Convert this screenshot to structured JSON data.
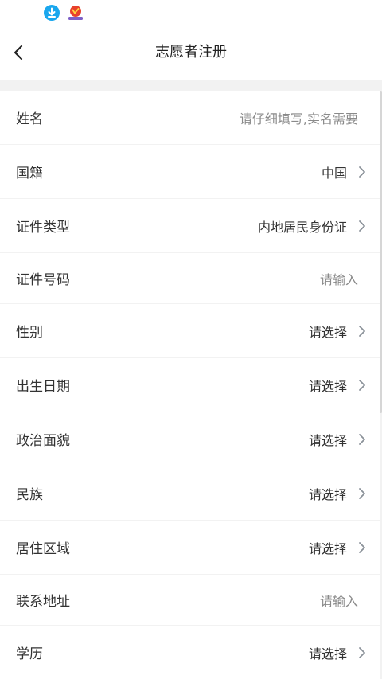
{
  "status_bar": {
    "icons": [
      "download-icon",
      "app-notification-icon"
    ],
    "download_color": "#1aa7ee"
  },
  "header": {
    "title": "志愿者注册",
    "back_icon": "chevron-left-icon"
  },
  "form": {
    "rows": [
      {
        "label": "姓名",
        "value": "请仔细填写,实名需要",
        "type": "input",
        "has_chevron": false
      },
      {
        "label": "国籍",
        "value": "中国",
        "type": "select",
        "has_chevron": true
      },
      {
        "label": "证件类型",
        "value": "内地居民身份证",
        "type": "select",
        "has_chevron": true
      },
      {
        "label": "证件号码",
        "value": "请输入",
        "type": "input",
        "has_chevron": false
      },
      {
        "label": "性别",
        "value": "请选择",
        "type": "select",
        "has_chevron": true
      },
      {
        "label": "出生日期",
        "value": "请选择",
        "type": "select",
        "has_chevron": true
      },
      {
        "label": "政治面貌",
        "value": "请选择",
        "type": "select",
        "has_chevron": true
      },
      {
        "label": "民族",
        "value": "请选择",
        "type": "select",
        "has_chevron": true
      },
      {
        "label": "居住区域",
        "value": "请选择",
        "type": "select",
        "has_chevron": true
      },
      {
        "label": "联系地址",
        "value": "请输入",
        "type": "input",
        "has_chevron": false
      },
      {
        "label": "学历",
        "value": "请选择",
        "type": "select",
        "has_chevron": true
      }
    ]
  },
  "colors": {
    "background": "#f2f2f2",
    "row_background": "#ffffff",
    "label_text": "#333333",
    "placeholder_text": "#8a8a8a",
    "chevron": "#8a9199"
  }
}
